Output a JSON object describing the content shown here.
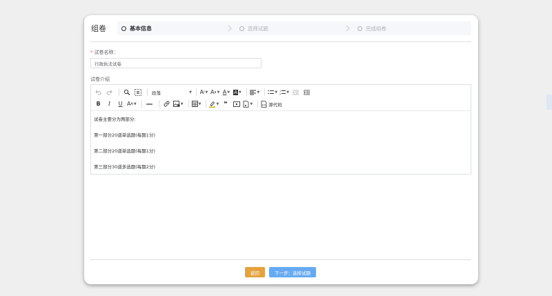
{
  "header": {
    "title": "组卷",
    "steps": [
      {
        "label": "基本信息",
        "active": true
      },
      {
        "label": "选择试题",
        "active": false
      },
      {
        "label": "完成组卷",
        "active": false
      }
    ]
  },
  "form": {
    "name_label": "试卷名称：",
    "name_required_mark": "*",
    "name_value": "行政执法试卷",
    "intro_label": "试卷介绍"
  },
  "editor": {
    "toolbar": {
      "paragraph_select": "段落",
      "source_code_label": "源代码"
    },
    "content": [
      "试卷主要分为两部分:",
      "第一部分20道单选题(每题1分)",
      "第二部分20道单选题(每题1分)",
      "第三部分30道多选题(每题2分)"
    ]
  },
  "footer": {
    "back_label": "返回",
    "next_label": "下一步：选择试题"
  },
  "colors": {
    "back_button": "#e6a23c",
    "next_button": "#66aaf4",
    "required": "#f56c6c"
  }
}
